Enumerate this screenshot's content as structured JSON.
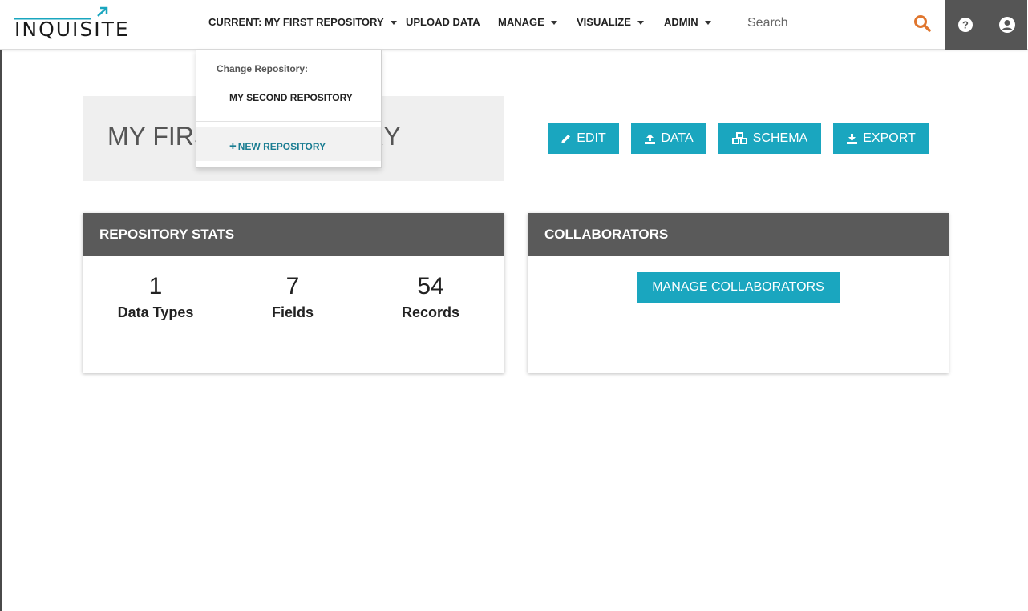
{
  "brand": {
    "name": "INQUISITE"
  },
  "nav": {
    "current_repo": "CURRENT: MY FIRST REPOSITORY",
    "upload": "UPLOAD DATA",
    "manage": "MANAGE",
    "visualize": "VISUALIZE",
    "admin": "ADMIN"
  },
  "search": {
    "placeholder": "Search"
  },
  "dropdown": {
    "header": "Change Repository:",
    "items": [
      "MY SECOND REPOSITORY"
    ],
    "new_label": "NEW REPOSITORY"
  },
  "page": {
    "title": "MY FIRST REPOSITORY"
  },
  "actions": {
    "edit": "EDIT",
    "data": "DATA",
    "schema": "SCHEMA",
    "export": "EXPORT"
  },
  "stats": {
    "heading": "REPOSITORY STATS",
    "items": [
      {
        "value": "1",
        "label": "Data Types"
      },
      {
        "value": "7",
        "label": "Fields"
      },
      {
        "value": "54",
        "label": "Records"
      }
    ]
  },
  "collaborators": {
    "heading": "COLLABORATORS",
    "manage_label": "MANAGE COLLABORATORS"
  },
  "colors": {
    "accent": "#1aa6bf",
    "search_icon": "#e0762e",
    "panel_header": "#5a5a5a"
  },
  "icons": [
    "pencil-icon",
    "upload-icon",
    "cubes-icon",
    "download-icon",
    "search-icon",
    "help-icon",
    "user-icon"
  ]
}
